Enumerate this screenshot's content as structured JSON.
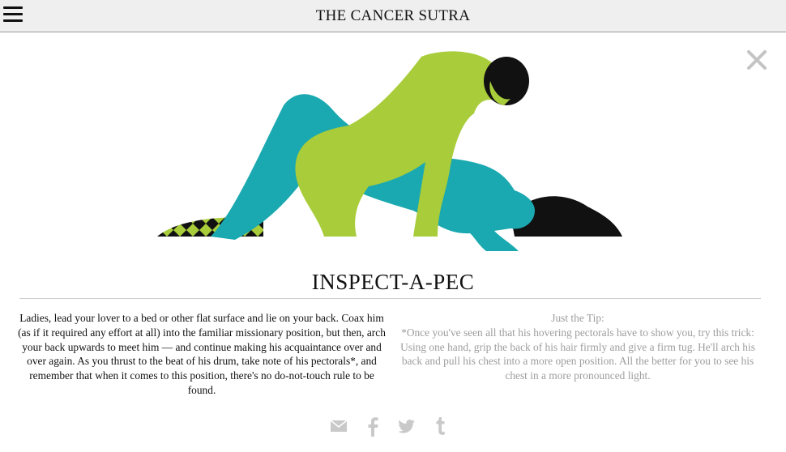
{
  "header": {
    "site_title": "THE CANCER SUTRA",
    "menu_icon": "hamburger-menu-icon",
    "close_icon": "close-icon"
  },
  "position": {
    "title": "INSPECT-A-PEC",
    "description": "Ladies, lead your lover to a bed or other flat surface and lie on your back. Coax him (as if it required any effort at all) into the familiar missionary position, but then, arch your back upwards to meet him — and continue making his acquaintance over and over again. As you thrust to the beat of his drum, take note of his pectorals*, and remember that when it comes to this position, there's no do-not-touch rule to be found.",
    "tip_heading": "Just the Tip:",
    "tip_body": "*Once you've seen all that his hovering pectorals have to show you, try this trick: Using one hand, grip the back of his hair firmly and give a firm tug. He'll arch his back and pull his chest into a more open position. All the better for you to see his chest in a more pronounced light."
  },
  "share": {
    "icons": [
      "email-icon",
      "facebook-icon",
      "twitter-icon",
      "tumblr-icon"
    ]
  },
  "colors": {
    "lime": "#a8cc3a",
    "teal": "#1aa9b0",
    "dark": "#111111",
    "muted": "#9d9d9d",
    "topbar_bg": "#efefef"
  }
}
